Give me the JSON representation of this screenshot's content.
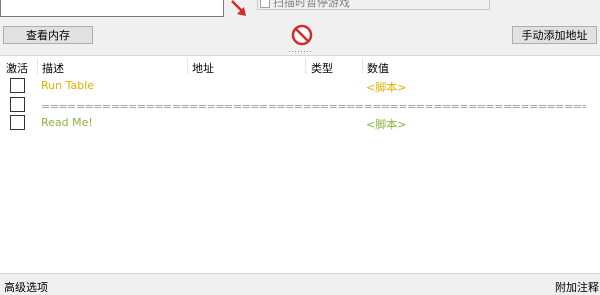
{
  "scan": {
    "pause_game_label": "扫描时暂停游戏"
  },
  "toolbar": {
    "view_memory_label": "查看内存",
    "add_address_label": "手动添加地址"
  },
  "table": {
    "headers": {
      "active": "激活",
      "description": "描述",
      "address": "地址",
      "type": "类型",
      "value": "数值"
    },
    "rows": [
      {
        "description": "Run Table",
        "value": "<脚本>",
        "color": "#e0b000"
      },
      {
        "description": "===================================================================================================",
        "value": "",
        "color": "#a0a0a0"
      },
      {
        "description": "Read Me!",
        "value": "<脚本>",
        "color": "#8ab43c"
      }
    ]
  },
  "footer": {
    "advanced_options_label": "高级选项",
    "table_extras_label": "附加注释"
  },
  "colors": {
    "script_yellow": "#e0b000",
    "script_green": "#8ab43c",
    "stop_red": "#d42a2a",
    "arrow_red": "#d42a2a"
  }
}
